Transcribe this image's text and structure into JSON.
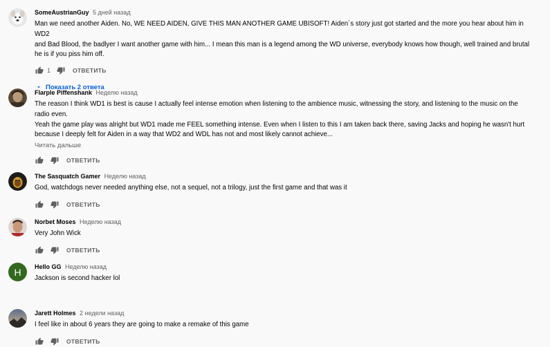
{
  "comments": [
    {
      "author": "SomeAustrianGuy",
      "time": "5 дней назад",
      "text_lines": [
        "Man we need another Aiden. No, WE NEED AIDEN, GIVE THIS MAN ANOTHER GAME UBISOFT! Aiden´s story just got started and the more you hear about him in WD2",
        "and Bad Blood, the badlyer I want another game with him... I mean this man is a legend among the WD universe, everybody knows how though, well trained and brutal",
        "he is if you piss him off."
      ],
      "likes": "1",
      "reply_label": "ОТВЕТИТЬ",
      "replies_label": "Показать 2 ответа",
      "avatar_bg": "#e8e8e8"
    },
    {
      "author": "Flarple Piffenshank",
      "time": "Неделю назад",
      "text_lines": [
        "The reason I think WD1 is best is cause I actually feel intense emotion when listening to the ambience music, witnessing the story, and listening to the music on the",
        "radio even.",
        "Yeah the game play was alright but WD1 made me FEEL something intense. Even when I listen to this I am taken back there, saving Jacks and hoping he wasn't hurt",
        "because I deeply felt for Aiden in a way that WD2 and WDL has not and most likely cannot achieve..."
      ],
      "read_more": "Читать дальше",
      "reply_label": "ОТВЕТИТЬ",
      "avatar_bg": "#6b5a45"
    },
    {
      "author": "The Sasquatch Gamer",
      "time": "Неделю назад",
      "text_lines": [
        "God, watchdogs never needed anything else, not a sequel, not a trilogy, just the first game and that was it"
      ],
      "reply_label": "ОТВЕТИТЬ",
      "avatar_bg": "#1e1c1a"
    },
    {
      "author": "Norbet Moses",
      "time": "Неделю назад",
      "text_lines": [
        "Very John Wick"
      ],
      "reply_label": "ОТВЕТИТЬ",
      "avatar_bg": "#c9a48c"
    },
    {
      "author": "Hello GG",
      "time": "Неделю назад",
      "text_lines": [
        "Jackson is second hacker lol"
      ],
      "reply_label": "ОТВЕТИТЬ",
      "avatar_letter": "H",
      "avatar_bg": "#33691e"
    },
    {
      "author": "Jarett Holmes",
      "time": "2 недели назад",
      "text_lines": [
        "I feel like in about 6 years they are going to make a remake of this game"
      ],
      "reply_label": "ОТВЕТИТЬ",
      "avatar_bg": "#4a5a75"
    }
  ],
  "icons": {
    "like": "thumb-up-icon",
    "dislike": "thumb-down-icon",
    "expand": "chevron-down-icon"
  },
  "colors": {
    "link_blue": "#065fd4",
    "secondary_text": "#606060",
    "background": "#f9f9f9"
  }
}
